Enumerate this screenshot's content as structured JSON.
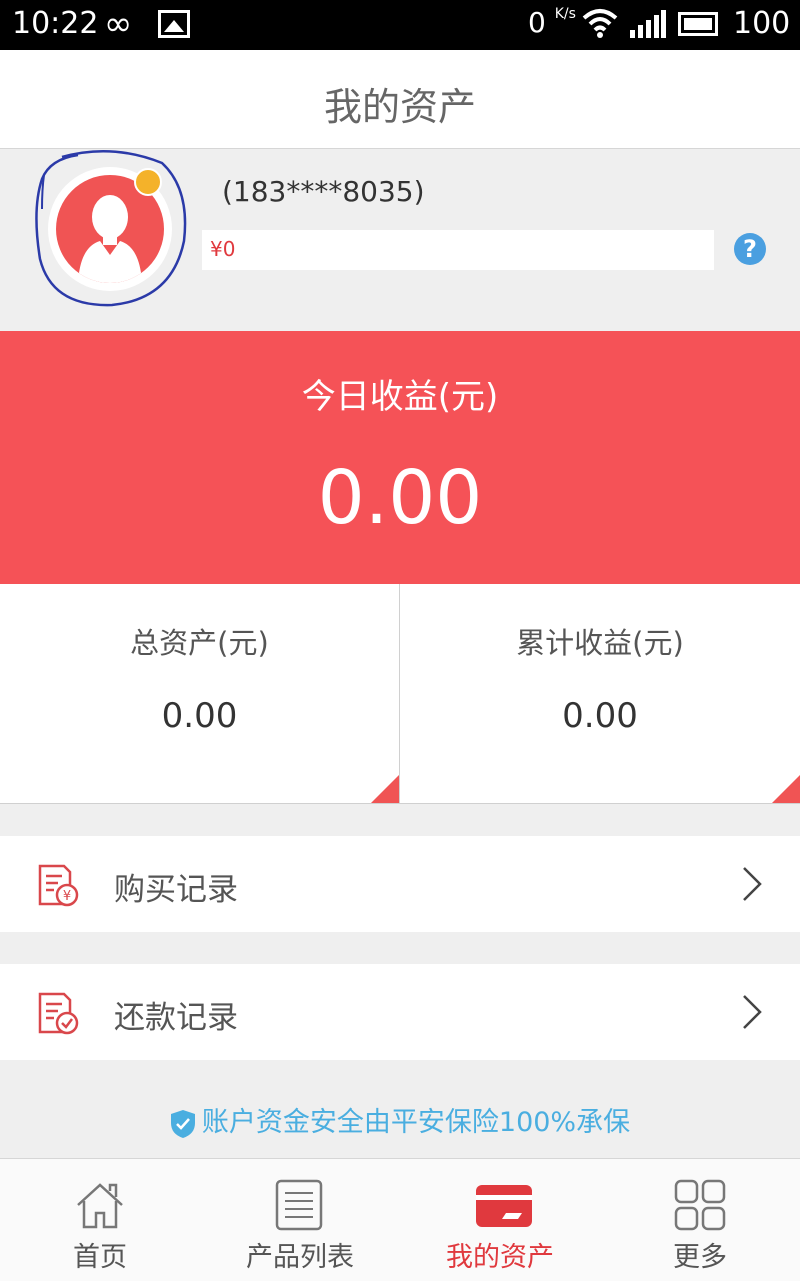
{
  "status_bar": {
    "time": "10:22",
    "data_speed": "0",
    "speed_unit": "K/s",
    "battery": "100"
  },
  "header": {
    "title": "我的资产"
  },
  "profile": {
    "phone": "(183****8035)",
    "balance": "¥0",
    "help_symbol": "?"
  },
  "today": {
    "label": "今日收益(元)",
    "value": "0.00"
  },
  "stats": {
    "total_assets": {
      "label": "总资产(元)",
      "value": "0.00"
    },
    "cumulative_income": {
      "label": "累计收益(元)",
      "value": "0.00"
    }
  },
  "menu": {
    "purchase_records": "购买记录",
    "repayment_records": "还款记录"
  },
  "security_note": "账户资金安全由平安保险100%承保",
  "bottom_nav": {
    "home": "首页",
    "products": "产品列表",
    "my_assets": "我的资产",
    "more": "更多"
  },
  "colors": {
    "accent_red": "#f55257",
    "active_red": "#e0393e",
    "info_blue": "#4aaee0",
    "help_blue": "#4a9fe0"
  }
}
